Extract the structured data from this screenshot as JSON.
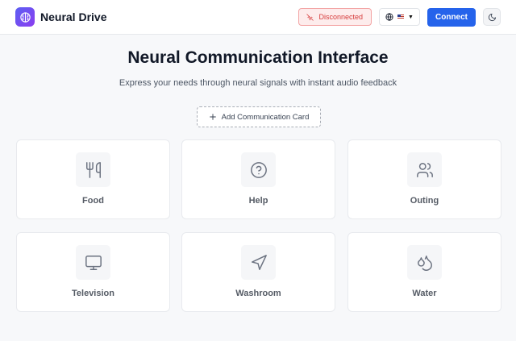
{
  "header": {
    "brand": "Neural Drive",
    "status_label": "Disconnected",
    "language_caret": "▼",
    "connect_label": "Connect"
  },
  "main": {
    "title": "Neural Communication Interface",
    "subtitle": "Express your needs through neural signals with instant audio feedback",
    "add_card_label": "Add Communication Card"
  },
  "cards": [
    {
      "label": "Food",
      "icon": "utensils-icon"
    },
    {
      "label": "Help",
      "icon": "help-circle-icon"
    },
    {
      "label": "Outing",
      "icon": "users-icon"
    },
    {
      "label": "Television",
      "icon": "monitor-icon"
    },
    {
      "label": "Washroom",
      "icon": "navigation-icon"
    },
    {
      "label": "Water",
      "icon": "droplets-icon"
    }
  ],
  "colors": {
    "accent": "#2563eb",
    "logo_gradient_start": "#5b5ff2",
    "logo_gradient_end": "#8b3df0",
    "status_text": "#d63b3b",
    "status_bg": "#fdecec"
  }
}
